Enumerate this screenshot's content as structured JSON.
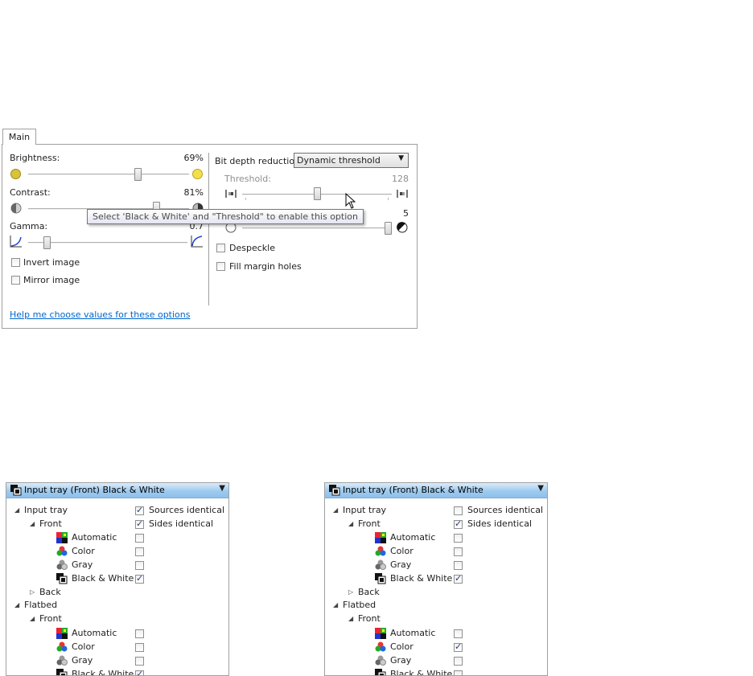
{
  "tabs": {
    "main": "Main"
  },
  "left": {
    "brightness": {
      "label": "Brightness:",
      "value": "69%",
      "level": 0.69
    },
    "contrast": {
      "label": "Contrast:",
      "value": "81%",
      "level": 0.81
    },
    "gamma": {
      "label": "Gamma:",
      "value": "0.7",
      "level": 0.1
    },
    "invert": {
      "label": "Invert image",
      "checked": false
    },
    "mirror": {
      "label": "Mirror image",
      "checked": false
    }
  },
  "right": {
    "bit_depth_label": "Bit depth reduction:",
    "bit_depth_value": "Dynamic threshold",
    "threshold": {
      "label": "Threshold:",
      "value": "128",
      "level": 0.5
    },
    "second_slider": {
      "value": "5",
      "level": 1.0
    },
    "despeckle": {
      "label": "Despeckle",
      "checked": false
    },
    "fill_margin": {
      "label": "Fill margin holes",
      "checked": false
    }
  },
  "tooltip": "Select 'Black & White' and \"Threshold\" to enable this option",
  "help_link": "Help me choose values for these options",
  "trees": [
    {
      "header": "Input tray (Front) Black & White",
      "rows": {
        "input_tray": "Input tray",
        "sources_identical": {
          "label": "Sources identical",
          "checked": true
        },
        "front": "Front",
        "sides_identical": {
          "label": "Sides identical",
          "checked": true
        },
        "automatic": {
          "label": "Automatic",
          "checked": false
        },
        "color": {
          "label": "Color",
          "checked": false
        },
        "gray": {
          "label": "Gray",
          "checked": false
        },
        "bw": {
          "label": "Black & White",
          "checked": true
        },
        "back": "Back",
        "flatbed": "Flatbed",
        "fb_front": "Front",
        "fb_automatic": {
          "label": "Automatic",
          "checked": false
        },
        "fb_color": {
          "label": "Color",
          "checked": false
        },
        "fb_gray": {
          "label": "Gray",
          "checked": false
        },
        "fb_bw": {
          "label": "Black & White",
          "checked": true
        }
      }
    },
    {
      "header": "Input tray (Front) Black & White",
      "rows": {
        "input_tray": "Input tray",
        "sources_identical": {
          "label": "Sources identical",
          "checked": false
        },
        "front": "Front",
        "sides_identical": {
          "label": "Sides identical",
          "checked": true
        },
        "automatic": {
          "label": "Automatic",
          "checked": false
        },
        "color": {
          "label": "Color",
          "checked": false
        },
        "gray": {
          "label": "Gray",
          "checked": false
        },
        "bw": {
          "label": "Black & White",
          "checked": true
        },
        "back": "Back",
        "flatbed": "Flatbed",
        "fb_front": "Front",
        "fb_automatic": {
          "label": "Automatic",
          "checked": false
        },
        "fb_color": {
          "label": "Color",
          "checked": true
        },
        "fb_gray": {
          "label": "Gray",
          "checked": false
        },
        "fb_bw": {
          "label": "Black & White",
          "checked": false
        }
      }
    }
  ],
  "icons": {
    "sun": "sun-icon",
    "contrast": "contrast-icon",
    "gamma": "gamma-curve-icon",
    "threshold": "threshold-icon",
    "noise": "noise-icon",
    "automatic": "automatic-mode-icon",
    "color": "color-mode-icon",
    "gray": "gray-mode-icon",
    "bw": "black-white-mode-icon"
  },
  "colors": {
    "link": "#0066cc",
    "header_blue": "#9dcaef",
    "sun": "#d8c33a"
  }
}
